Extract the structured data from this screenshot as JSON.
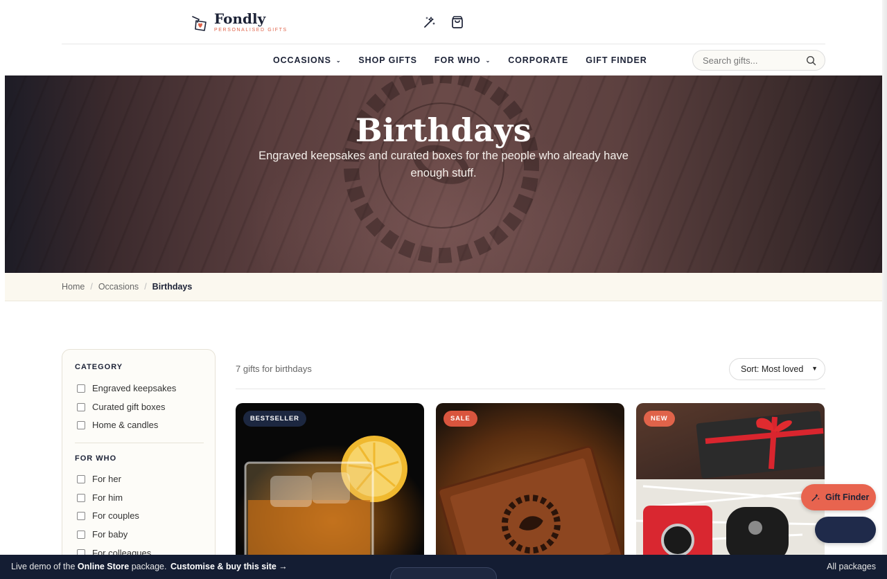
{
  "brand": {
    "name": "Fondly",
    "tagline": "PERSONALISED GIFTS",
    "accent": "#e0634a",
    "navy": "#1c2236"
  },
  "header": {
    "icons": [
      "magic-wand-icon",
      "shopping-bag-icon"
    ]
  },
  "nav": {
    "items": [
      {
        "label": "OCCASIONS",
        "has_dropdown": true
      },
      {
        "label": "SHOP GIFTS",
        "has_dropdown": false
      },
      {
        "label": "FOR WHO",
        "has_dropdown": true
      },
      {
        "label": "CORPORATE",
        "has_dropdown": false
      },
      {
        "label": "GIFT FINDER",
        "has_dropdown": false
      }
    ],
    "search": {
      "placeholder": "Search gifts...",
      "value": ""
    }
  },
  "hero": {
    "title": "Birthdays",
    "subtitle": "Engraved keepsakes and curated boxes for the people who already have enough stuff."
  },
  "breadcrumb": [
    "Home",
    "Occasions",
    "Birthdays"
  ],
  "sidebar": {
    "category": {
      "heading": "CATEGORY",
      "options": [
        "Engraved keepsakes",
        "Curated gift boxes",
        "Home & candles"
      ]
    },
    "for_who": {
      "heading": "FOR WHO",
      "options": [
        "For her",
        "For him",
        "For couples",
        "For baby",
        "For colleagues"
      ]
    }
  },
  "results": {
    "count_text": "7 gifts for birthdays",
    "sort_label": "Sort: Most loved"
  },
  "products": [
    {
      "badge": "BESTSELLER",
      "badge_color": "#1c2740",
      "image": "whiskey-glass-image"
    },
    {
      "badge": "SALE",
      "badge_color": "#d9553e",
      "image": "engraved-wood-box-image"
    },
    {
      "badge": "NEW",
      "badge_color": "#e0634a",
      "image": "gift-box-accessories-image"
    }
  ],
  "floating": {
    "gift_finder": "Gift Finder"
  },
  "demo_bar": {
    "prefix": "Live demo of the",
    "package": "Online Store",
    "suffix": "package.",
    "cta": "Customise & buy this site →",
    "right": "All packages"
  }
}
